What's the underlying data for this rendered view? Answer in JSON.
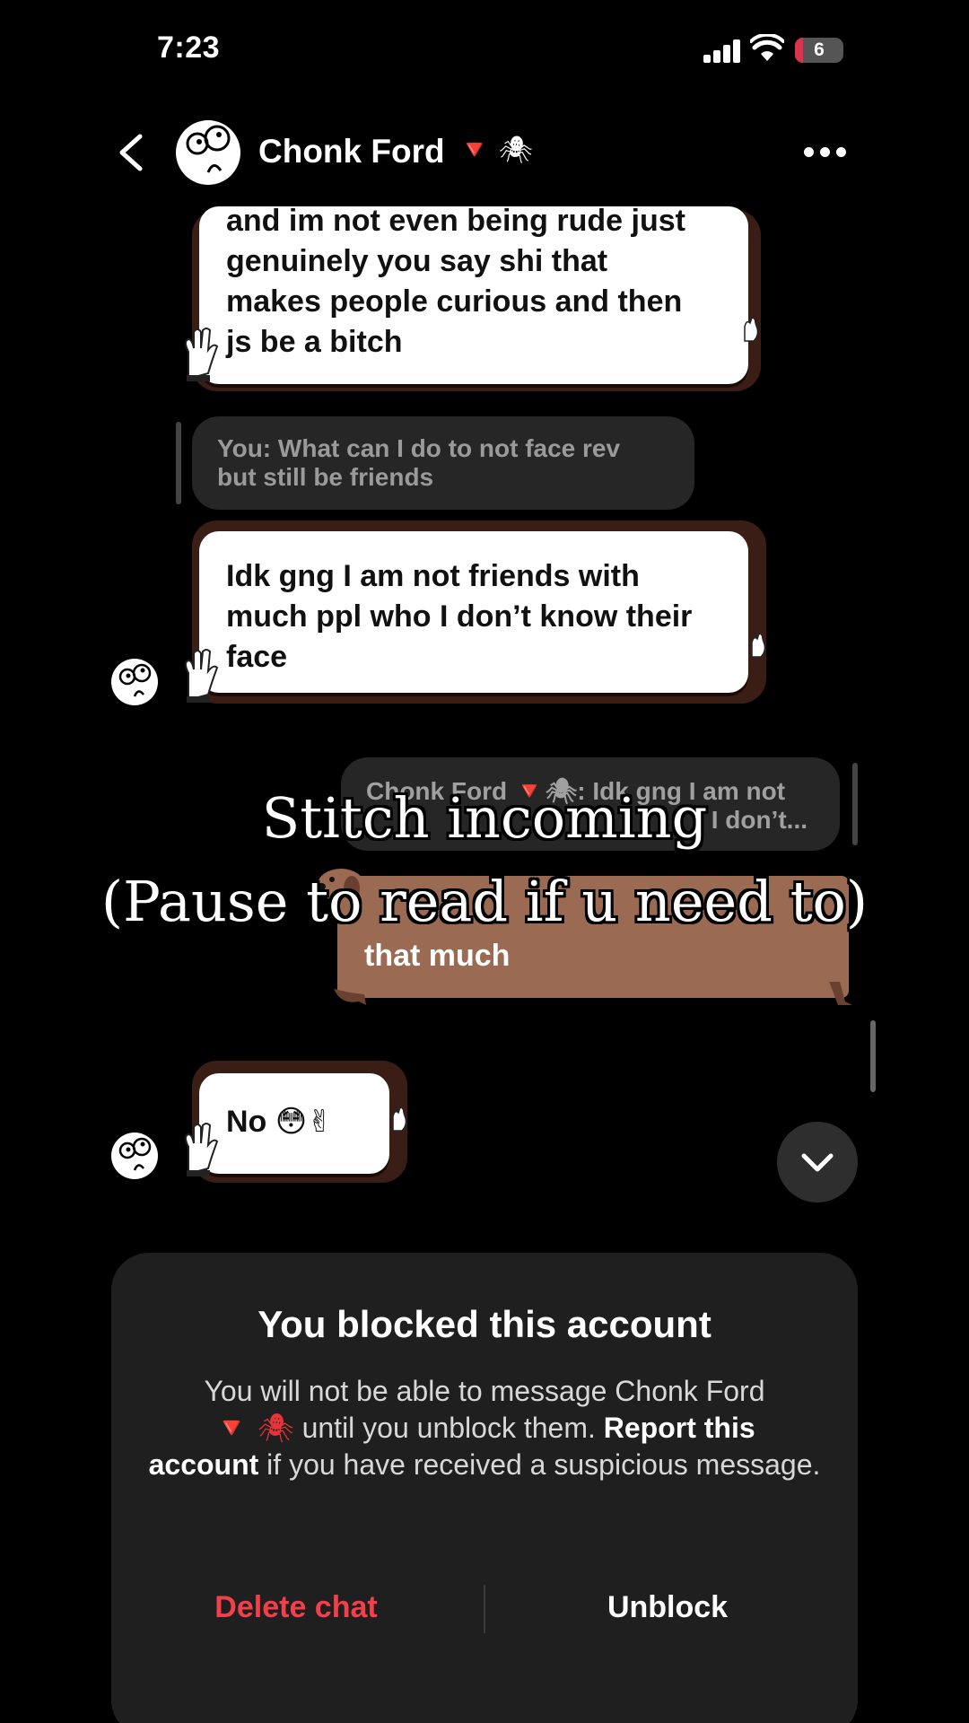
{
  "status_bar": {
    "time": "7:23",
    "battery": "6"
  },
  "header": {
    "name": "Chonk Ford",
    "deco_triangle": "🔻",
    "deco_spider": "🕷"
  },
  "messages": {
    "m1": {
      "lines": [
        "and im not even being rude just",
        "genuinely you say shi that",
        "makes people curious and then",
        "js be a bitch"
      ]
    },
    "reply1": {
      "lines": [
        "You: What can I do to not face rev",
        "but still be friends"
      ]
    },
    "m2": {
      "lines": [
        "Idk gng I am not friends with",
        "much ppl who I don’t know their",
        "face"
      ]
    },
    "reply2": {
      "line1": "Chonk Ford 🔻🕷: Idk gng I am not",
      "line2": "I don’t..."
    },
    "m3": {
      "line2": "that much"
    },
    "m4": {
      "text": "No 😳✌"
    }
  },
  "caption": {
    "line1": "Stitch incoming",
    "line2": "(Pause to read if u need to)"
  },
  "blocked": {
    "title": "You blocked this account",
    "text_a": "You will not be able to message Chonk Ford",
    "text_deco": "🔻 🕷",
    "text_b": " until you unblock them. ",
    "text_bold1": "Report this",
    "text_bold2": "account",
    "text_c": " if you have received a suspicious message.",
    "delete_label": "Delete chat",
    "unblock_label": "Unblock"
  },
  "colors": {
    "delete": "#f2404a",
    "bubble_outline": "#3a1e16",
    "brown_bubble": "#9b6a52",
    "panel": "#1f1f1f"
  },
  "icons": [
    "chevron-left-icon",
    "more-dots-icon",
    "chevron-down-icon",
    "wifi-icon",
    "signal-icon",
    "battery-icon",
    "hand-icon",
    "dachshund-icon"
  ]
}
